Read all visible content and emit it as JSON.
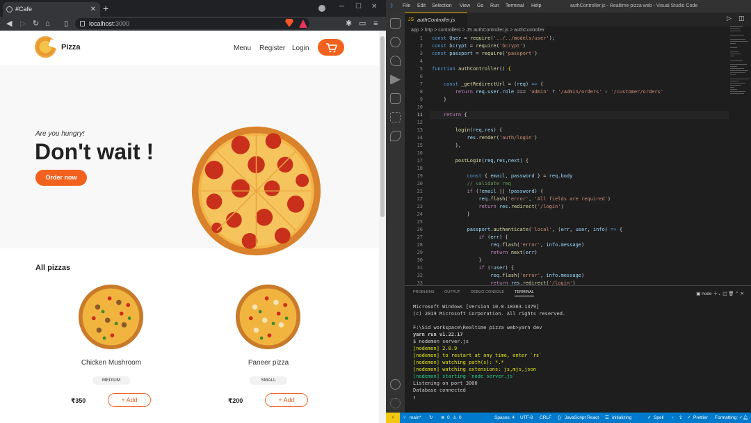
{
  "browser": {
    "tab_title": "#Cafe",
    "url_host": "localhost",
    "url_port": ":3000"
  },
  "site": {
    "brand": "Pizza",
    "nav": [
      "Menu",
      "Register",
      "Login"
    ],
    "hero_subtitle": "Are you hungry!",
    "hero_title": "Don't wait !",
    "order_button": "Order now",
    "section_title": "All pizzas",
    "pizzas": [
      {
        "name": "Chicken Mushroom",
        "size": "MEDIUM",
        "price": "₹350",
        "add_label": "+ Add"
      },
      {
        "name": "Paneer pizza",
        "size": "SMALL",
        "price": "₹200",
        "add_label": "+ Add"
      }
    ]
  },
  "vscode": {
    "menu": [
      "File",
      "Edit",
      "Selection",
      "View",
      "Go",
      "Run",
      "Terminal",
      "Help"
    ],
    "window_title": "authController.js - Realtime pizza web - Visual Studio Code",
    "file_tab": "authController.js",
    "breadcrumb": "app > http > controllers > JS authController.js > authController",
    "current_line": 11,
    "line_start": 1,
    "panel_tabs": [
      "PROBLEMS",
      "OUTPUT",
      "DEBUG CONSOLE",
      "TERMINAL"
    ],
    "terminal_shell": "node",
    "status": {
      "branch": "main*",
      "errors": "0",
      "warnings": "0",
      "spaces": "Spaces: 4",
      "encoding": "UTF-8",
      "eol": "CRLF",
      "language": "JavaScript React",
      "initializing": "initializing",
      "spell": "Spell",
      "prettier": "Prettier",
      "formatting": "Formatting: ✓"
    }
  }
}
